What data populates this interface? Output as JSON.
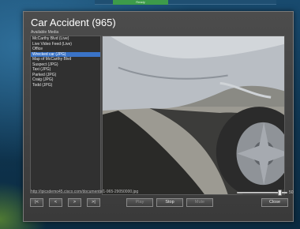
{
  "window": {
    "title": "Car Accident (965)",
    "subtitle": "Available Media"
  },
  "media_list": {
    "items": [
      "McCarthy Blvd (Live)",
      "Live Video Feed (Live)",
      "Office",
      "Wrecked car (JPG)",
      "Map of McCarthy Blvd",
      "Suspect (JPG)",
      "Taxi (JPG)",
      "Parked (JPG)",
      "Craig (JPG)",
      "Todd (JPG)"
    ],
    "selected_index": 3
  },
  "viewer": {
    "url": "http://ipicsdemo45.cisco.com/documents/1-965-29050000.jpg",
    "zoom_level": 0.85,
    "zoom_value": "50"
  },
  "controls": {
    "first": "|<",
    "prev": "<",
    "next": ">",
    "last": ">|",
    "play": "Play",
    "stop": "Stop",
    "mute": "Mute",
    "close": "Close"
  },
  "background": {
    "top_button_label": "Ready"
  },
  "colors": {
    "selection": "#3a73c7",
    "window_bg": "#3a3a3a"
  }
}
